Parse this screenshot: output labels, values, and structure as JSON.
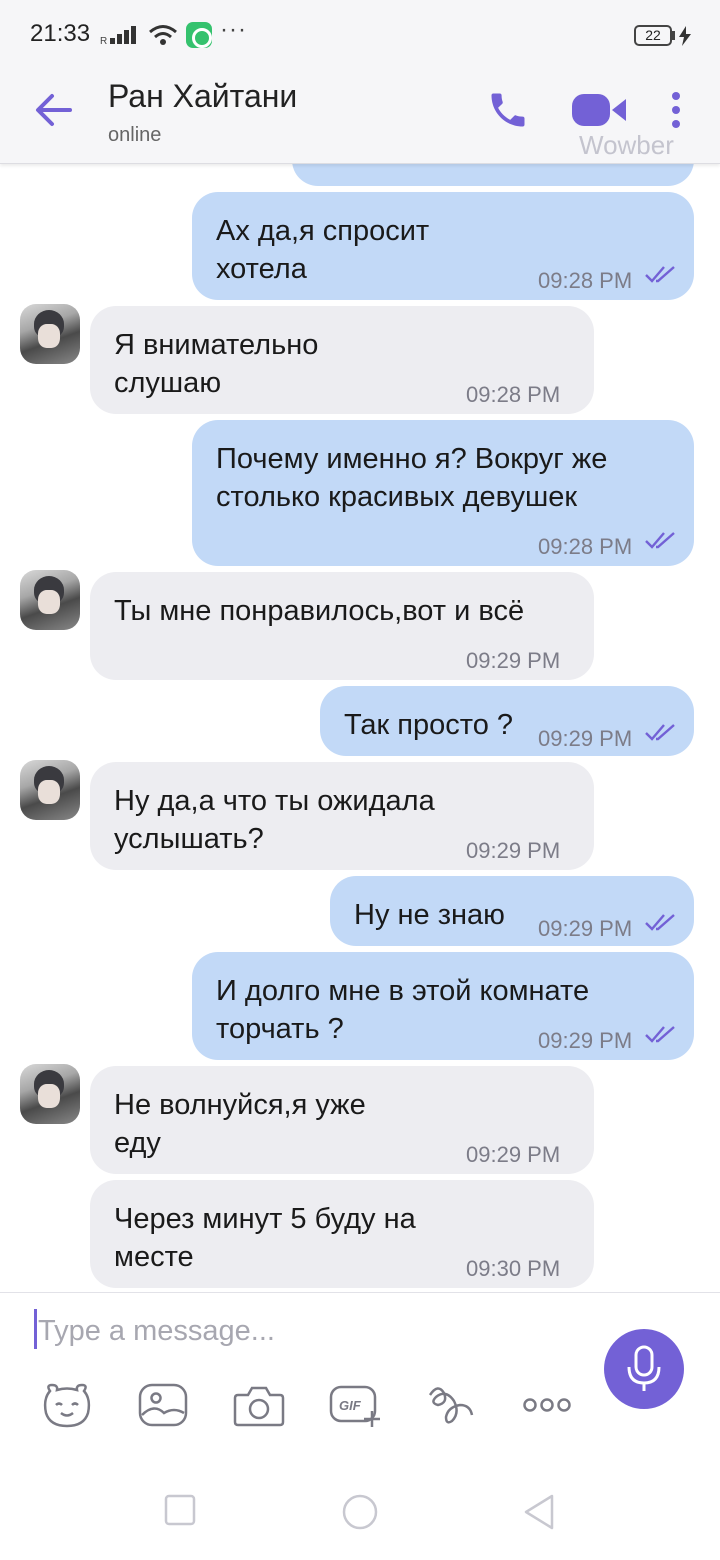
{
  "status_bar": {
    "time": "21:33",
    "battery": "22"
  },
  "header": {
    "contact_name": "Ран Хайтани",
    "contact_status": "online",
    "watermark": "Wowber"
  },
  "messages": [
    {
      "dir": "out",
      "text": "Ах да,я спросит хотела",
      "time": "09:28 PM"
    },
    {
      "dir": "in",
      "text": "Я внимательно слушаю",
      "time": "09:28 PM"
    },
    {
      "dir": "out",
      "text": "Почему именно я? Вокруг же столько красивых девушек",
      "time": "09:28 PM"
    },
    {
      "dir": "in",
      "text": "Ты мне понравилось,вот и всё",
      "time": "09:29 PM"
    },
    {
      "dir": "out",
      "text": "Так просто ?",
      "time": "09:29 PM"
    },
    {
      "dir": "in",
      "text": "Ну да,а что ты ожидала услышать?",
      "time": "09:29 PM"
    },
    {
      "dir": "out",
      "text": "Ну не знаю",
      "time": "09:29 PM"
    },
    {
      "dir": "out",
      "text": "И долго мне в этой комнате торчать ?",
      "time": "09:29 PM"
    },
    {
      "dir": "in",
      "text": "Не волнуйся,я уже еду",
      "time": "09:29 PM"
    },
    {
      "dir": "in",
      "text": "Через минут 5 буду на месте",
      "time": "09:30 PM"
    }
  ],
  "composer": {
    "placeholder": "Type a message..."
  },
  "toolbar_icons": [
    "sticker-icon",
    "gallery-icon",
    "camera-icon",
    "gif-icon",
    "doodle-icon",
    "more-icon"
  ],
  "colors": {
    "accent": "#7361d6",
    "outgoing_bubble": "#c2d9f7",
    "incoming_bubble": "#ededf1"
  }
}
